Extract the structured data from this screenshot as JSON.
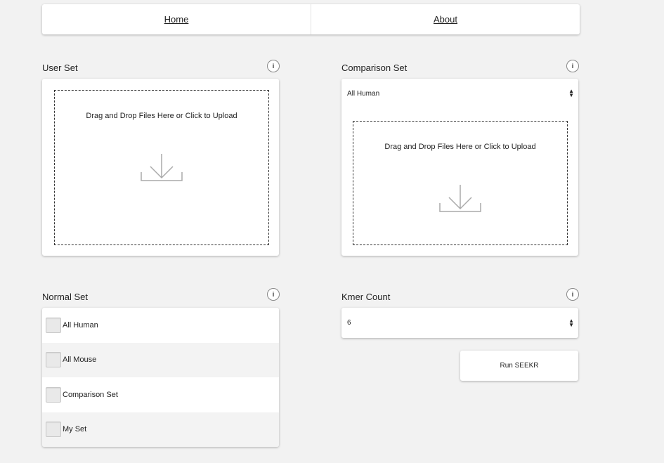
{
  "nav": {
    "home": "Home",
    "about": "About"
  },
  "user_set": {
    "label": "User Set",
    "info": "i",
    "dropzone_text": "Drag and Drop Files Here or Click to Upload"
  },
  "comparison_set": {
    "label": "Comparison Set",
    "info": "i",
    "selected": "All Human",
    "dropzone_text": "Drag and Drop Files Here or Click to Upload"
  },
  "normal_set": {
    "label": "Normal Set",
    "info": "i",
    "options": [
      "All Human",
      "All Mouse",
      "Comparison Set",
      "My Set"
    ]
  },
  "kmer_count": {
    "label": "Kmer Count",
    "info": "i",
    "selected": "6"
  },
  "run_button": "Run SEEKR"
}
